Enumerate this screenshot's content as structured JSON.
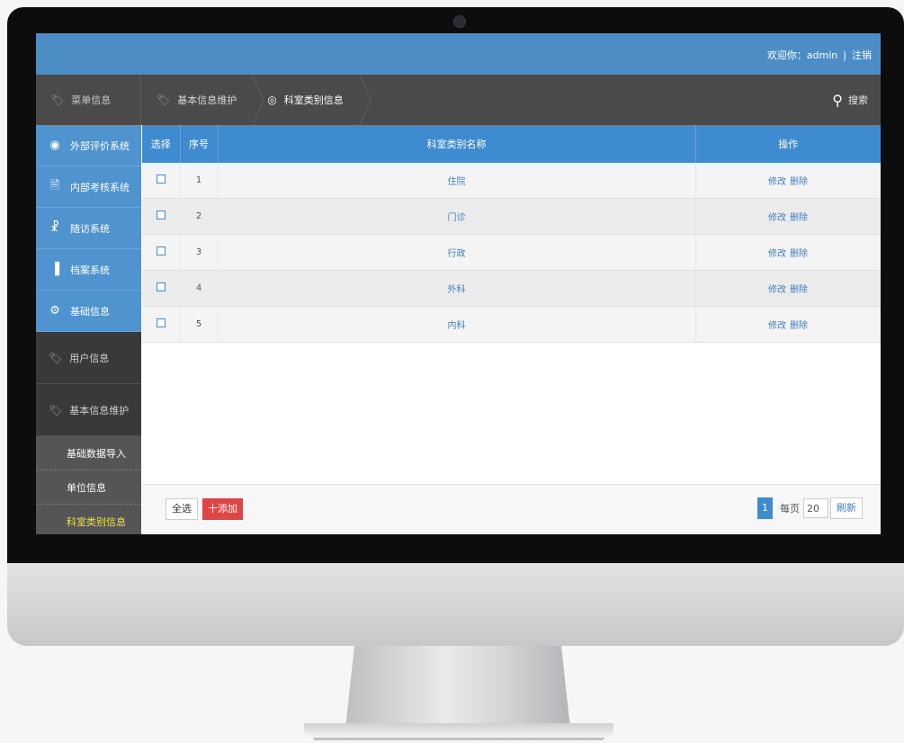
{
  "topbar": {
    "welcome": "欢迎你：admin",
    "separator": "|",
    "logout": "注销"
  },
  "nav": {
    "section": "菜单信息",
    "breadcrumbs": [
      "基本信息维护",
      "科室类别信息"
    ],
    "search": "搜索"
  },
  "sidebar": {
    "blue_items": [
      {
        "label": "外部评价系统",
        "icon": "target-icon"
      },
      {
        "label": "内部考核系统",
        "icon": "document-icon"
      },
      {
        "label": "随访系统",
        "icon": "stethoscope-icon"
      },
      {
        "label": "档案系统",
        "icon": "chart-icon"
      },
      {
        "label": "基础信息",
        "icon": "gear-icon"
      }
    ],
    "dark_items": [
      "用户信息",
      "基本信息维护"
    ],
    "sub_items": [
      "基础数据导入",
      "单位信息",
      "科室类别信息"
    ]
  },
  "table": {
    "headers": [
      "选择",
      "序号",
      "科室类别名称",
      "操作"
    ],
    "rows": [
      {
        "no": "1",
        "name": "住院",
        "edit": "修改",
        "delete": "删除"
      },
      {
        "no": "2",
        "name": "门诊",
        "edit": "修改",
        "delete": "删除"
      },
      {
        "no": "3",
        "name": "行政",
        "edit": "修改",
        "delete": "删除"
      },
      {
        "no": "4",
        "name": "外科",
        "edit": "修改",
        "delete": "删除"
      },
      {
        "no": "5",
        "name": "内科",
        "edit": "修改",
        "delete": "删除"
      }
    ]
  },
  "footer": {
    "select_all": "全选",
    "add": "十添加",
    "current_page": "1",
    "per_page_label": "每页",
    "per_page_value": "20",
    "refresh": "刷新"
  },
  "colors": {
    "accent": "#4d8dc6",
    "sidebar_dark": "#3d3d3d",
    "add_button": "#e04545"
  }
}
